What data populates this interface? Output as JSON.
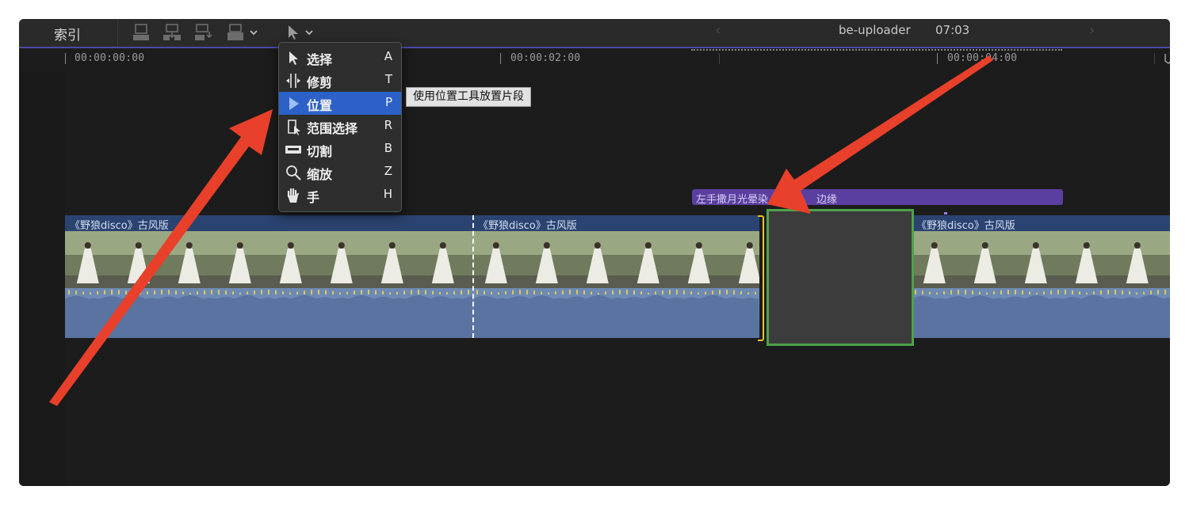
{
  "toolbar": {
    "index_label": "索引",
    "project_name": "be-uploader",
    "project_time": "07:03",
    "prev_icon": "chevron-left-icon",
    "next_icon": "chevron-right-icon"
  },
  "ruler": {
    "timecodes": [
      "00:00:00:00",
      "00:00:02:00",
      "00:00:04:00"
    ]
  },
  "tool_menu": {
    "items": [
      {
        "label": "选择",
        "key": "A",
        "icon": "arrow-icon"
      },
      {
        "label": "修剪",
        "key": "T",
        "icon": "trim-icon"
      },
      {
        "label": "位置",
        "key": "P",
        "icon": "position-icon",
        "selected": true
      },
      {
        "label": "范围选择",
        "key": "R",
        "icon": "range-select-icon"
      },
      {
        "label": "切割",
        "key": "B",
        "icon": "blade-icon"
      },
      {
        "label": "缩放",
        "key": "Z",
        "icon": "zoom-icon"
      },
      {
        "label": "手",
        "key": "H",
        "icon": "hand-icon"
      }
    ],
    "tooltip": "使用位置工具放置片段"
  },
  "timeline": {
    "title_clip": {
      "text_left": "左手撒月光晕染",
      "text_right": "边缘"
    },
    "clips": [
      {
        "name": "《野狼disco》古风版"
      },
      {
        "name": "《野狼disco》古风版"
      },
      {
        "name": "《野狼disco》古风版"
      }
    ]
  },
  "colors": {
    "accent": "#2c62c8",
    "clip_blue": "#2b4370",
    "audio_blue": "#6e8ab4",
    "gap_border": "#4da34a",
    "title_purple": "#5a3fa0",
    "annotation_red": "#e8402a"
  }
}
